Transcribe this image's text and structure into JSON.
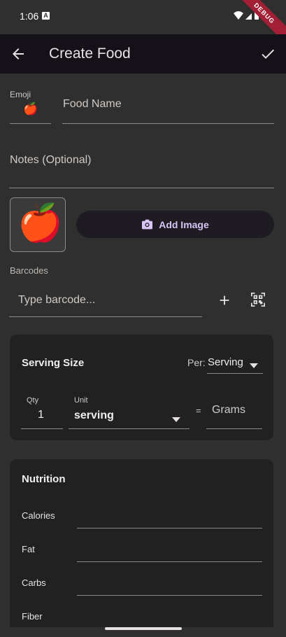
{
  "status": {
    "time": "1:06",
    "debug": "DEBUG"
  },
  "appbar": {
    "title": "Create Food"
  },
  "emoji": {
    "label": "Emoji",
    "value": "🍎"
  },
  "food_name": {
    "placeholder": "Food Name"
  },
  "notes": {
    "placeholder": "Notes (Optional)"
  },
  "image": {
    "emoji": "🍎",
    "add_label": "Add Image"
  },
  "barcodes": {
    "label": "Barcodes",
    "placeholder": "Type barcode..."
  },
  "serving": {
    "title": "Serving Size",
    "per_label": "Per:",
    "per_value": "Serving",
    "qty_label": "Qty",
    "qty_value": "1",
    "unit_label": "Unit",
    "unit_value": "serving",
    "equals": "=",
    "grams_placeholder": "Grams"
  },
  "nutrition": {
    "title": "Nutrition",
    "fields": [
      "Calories",
      "Fat",
      "Carbs",
      "Fiber"
    ]
  },
  "colors": {
    "accent": "#d7c5f7",
    "card": "#212121",
    "background": "#2f2f2f",
    "appbar": "#141218"
  }
}
